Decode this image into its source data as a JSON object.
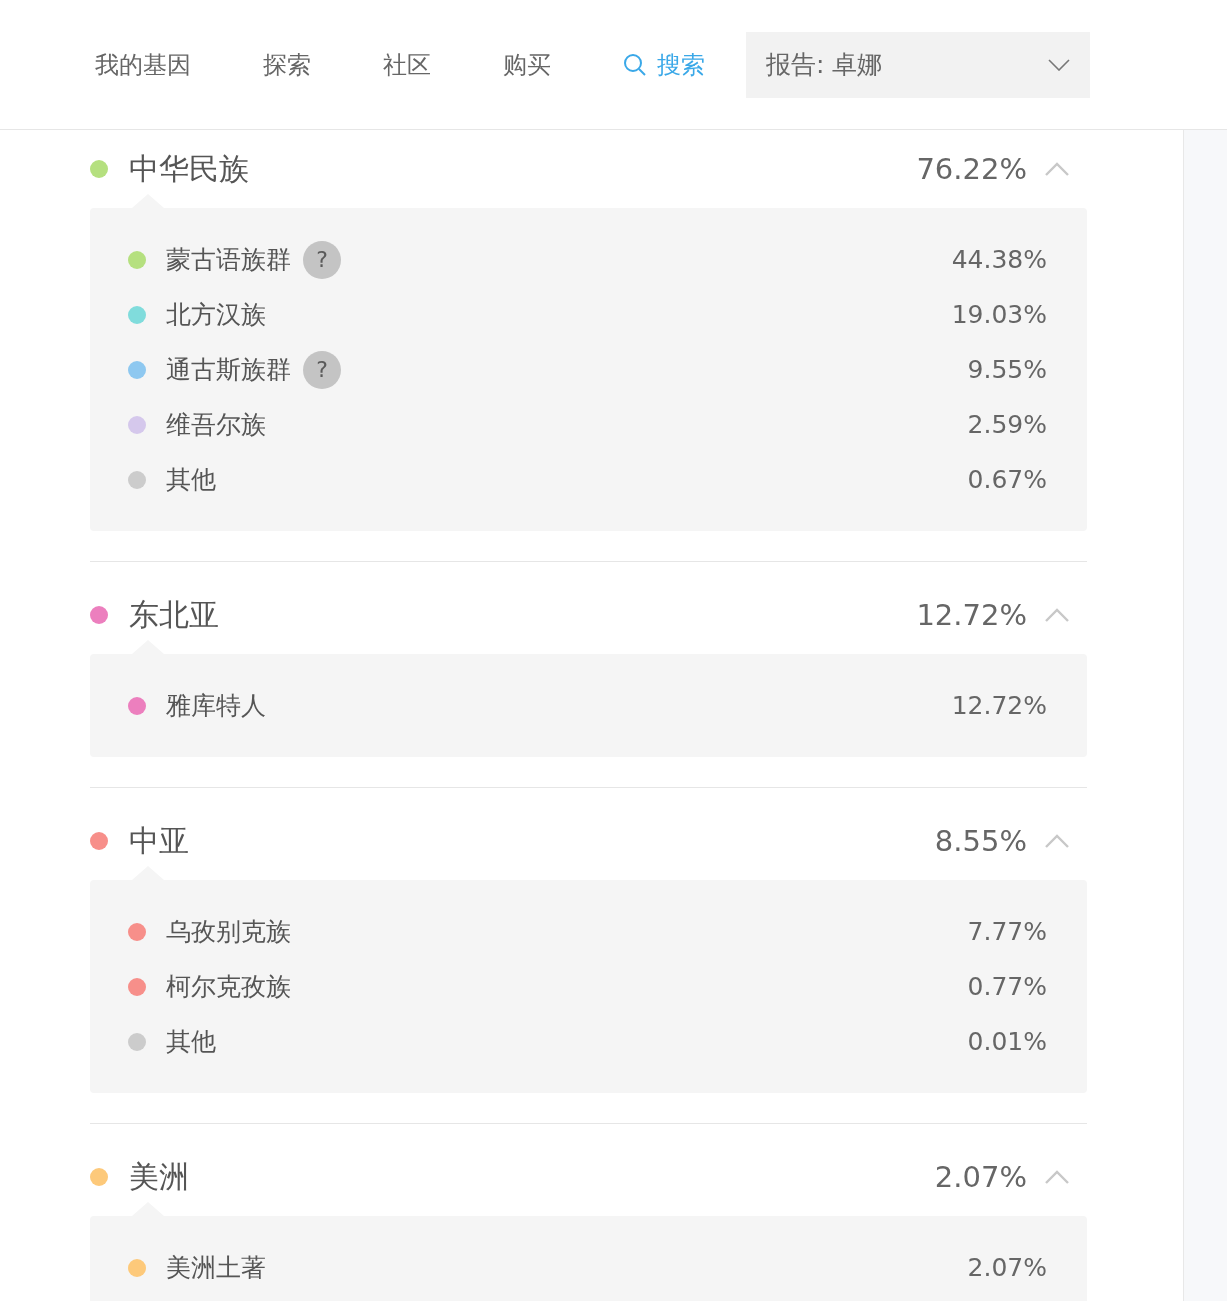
{
  "nav": [
    {
      "label": "我的基因",
      "kind": "link"
    },
    {
      "label": "探索",
      "kind": "link"
    },
    {
      "label": "社区",
      "kind": "link"
    },
    {
      "label": "购买",
      "kind": "link"
    },
    {
      "label": "搜索",
      "kind": "search"
    }
  ],
  "report_select": {
    "value": "报告: 卓娜"
  },
  "groups": [
    {
      "name": "中华民族",
      "percent": "76.22%",
      "color": "#b5e07f",
      "expanded": true,
      "items": [
        {
          "name": "蒙古语族群",
          "percent": "44.38%",
          "color": "#b5e07f",
          "help": "?"
        },
        {
          "name": "北方汉族",
          "percent": "19.03%",
          "color": "#80dcdc"
        },
        {
          "name": "通古斯族群",
          "percent": "9.55%",
          "color": "#8ec8f0",
          "help": "?"
        },
        {
          "name": "维吾尔族",
          "percent": "2.59%",
          "color": "#d5c8ec"
        },
        {
          "name": "其他",
          "percent": "0.67%",
          "color": "#cccccc"
        }
      ]
    },
    {
      "name": "东北亚",
      "percent": "12.72%",
      "color": "#ec7fbe",
      "expanded": true,
      "items": [
        {
          "name": "雅库特人",
          "percent": "12.72%",
          "color": "#ec7fbe"
        }
      ]
    },
    {
      "name": "中亚",
      "percent": "8.55%",
      "color": "#f78f8a",
      "expanded": true,
      "items": [
        {
          "name": "乌孜别克族",
          "percent": "7.77%",
          "color": "#f78f8a"
        },
        {
          "name": "柯尔克孜族",
          "percent": "0.77%",
          "color": "#f78f8a"
        },
        {
          "name": "其他",
          "percent": "0.01%",
          "color": "#cccccc"
        }
      ]
    },
    {
      "name": "美洲",
      "percent": "2.07%",
      "color": "#fdc97a",
      "expanded": true,
      "items": [
        {
          "name": "美洲土著",
          "percent": "2.07%",
          "color": "#fdc97a"
        }
      ]
    }
  ]
}
